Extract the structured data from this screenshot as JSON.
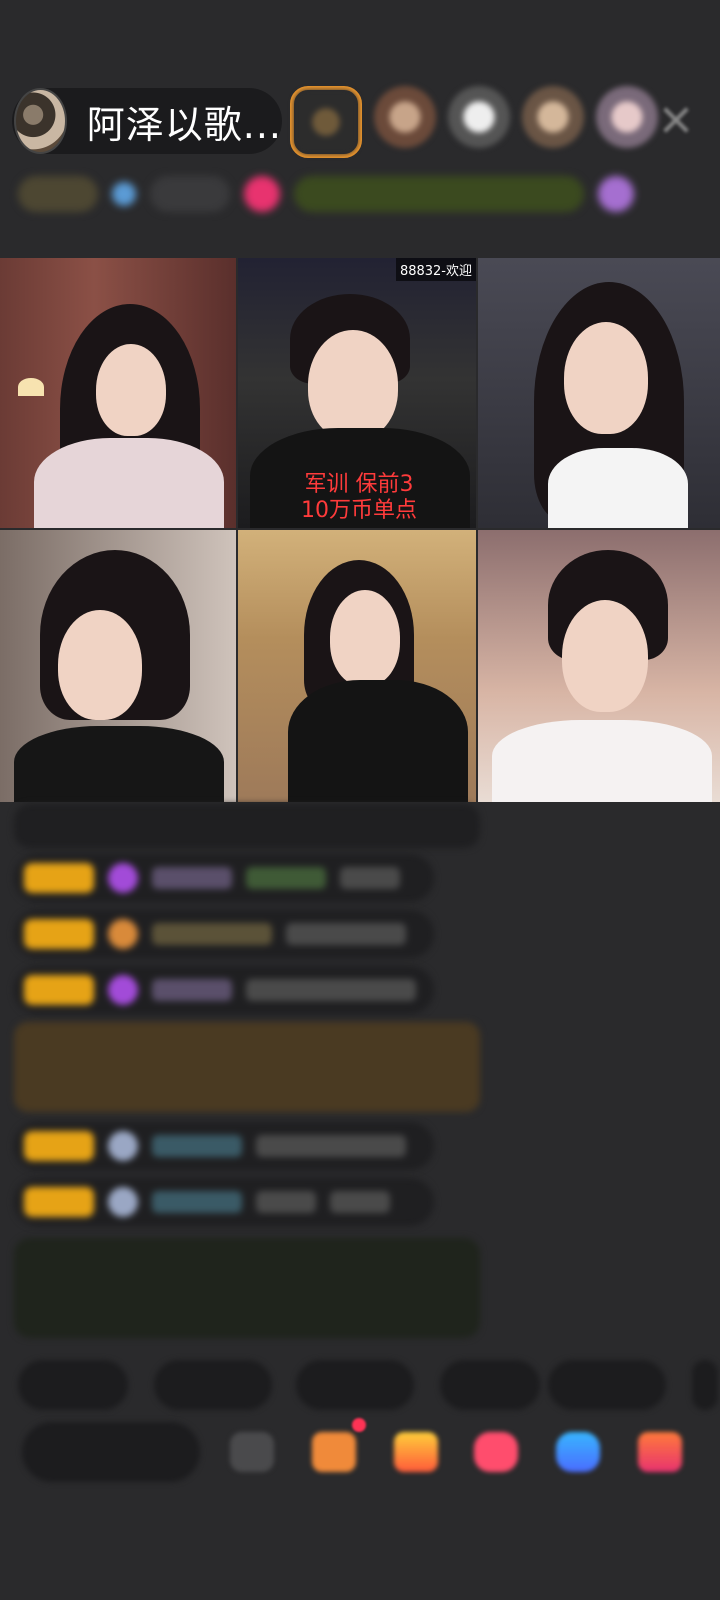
{
  "header": {
    "host_name": "阿泽以歌...",
    "close_icon": "close-icon"
  },
  "video_tiles": [
    {
      "id": "t1",
      "label": "",
      "tag": ""
    },
    {
      "id": "t2",
      "overlay_line1": "军训 保前3",
      "overlay_line2": "10万币单点",
      "tag": "88832-欢迎"
    },
    {
      "id": "t3"
    },
    {
      "id": "t4"
    },
    {
      "id": "t5"
    },
    {
      "id": "t6"
    }
  ],
  "colors": {
    "background": "#2a2a2c",
    "accent_orange": "#f29a2e",
    "badge_yellow": "#e6a316",
    "overlay_red": "#ff3b3b"
  }
}
